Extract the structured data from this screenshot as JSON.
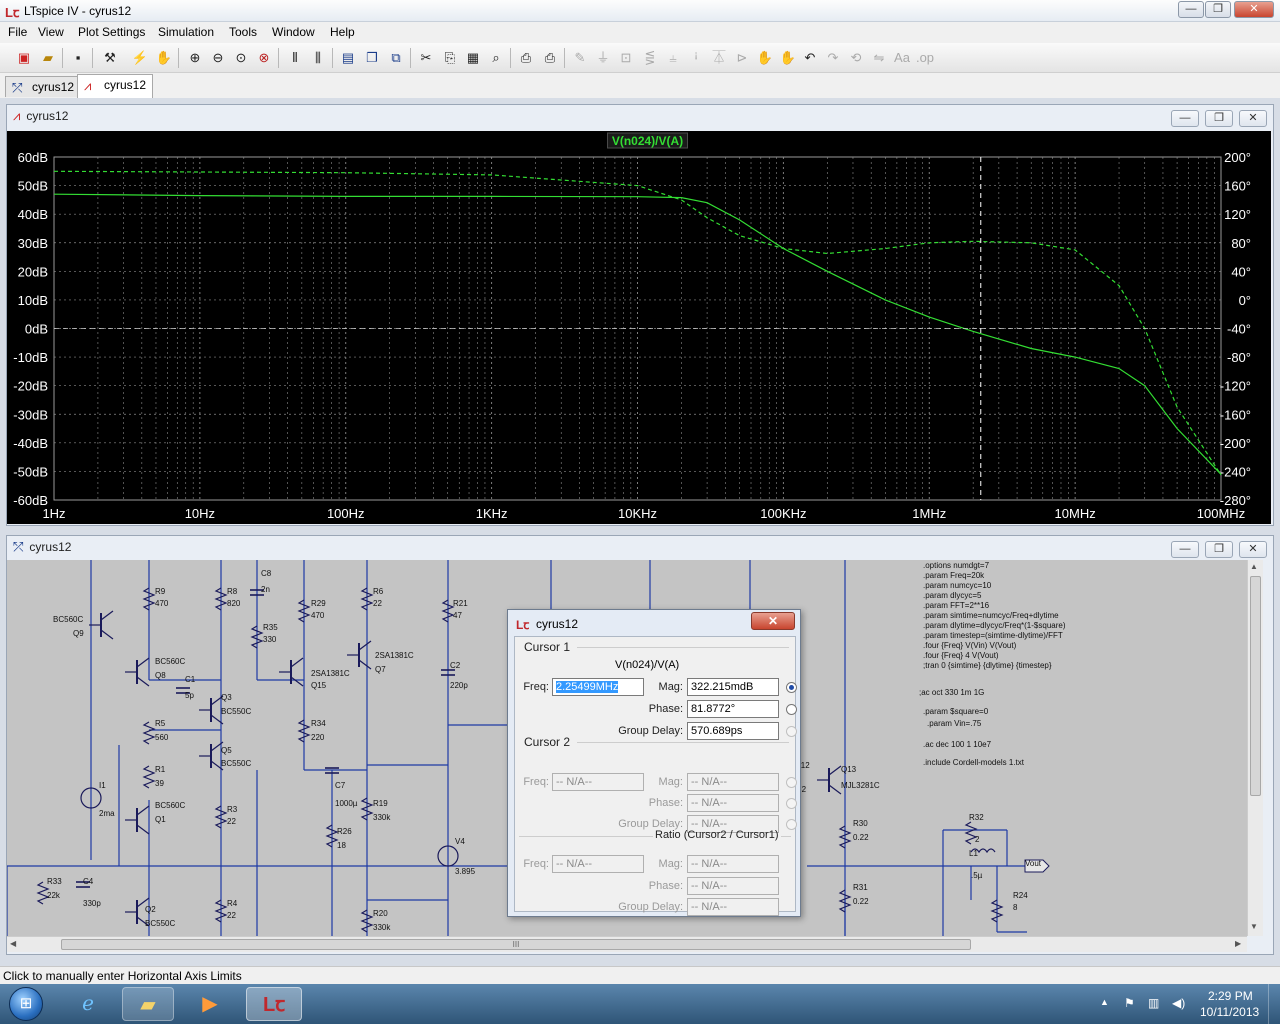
{
  "window": {
    "title": "LTspice IV - cyrus12"
  },
  "menu": [
    "File",
    "View",
    "Plot Settings",
    "Simulation",
    "Tools",
    "Window",
    "Help"
  ],
  "toolbar_icons": [
    "new-schematic-icon",
    "open-icon",
    "save-icon",
    "control-panel-icon",
    "run-icon",
    "halt-icon",
    "zoom-in-icon",
    "zoom-out-icon",
    "zoom-extents-icon",
    "zoom-cancel-icon",
    "autorange-icon",
    "mark-icon",
    "tile-horizontal-icon",
    "cascade-icon",
    "close-all-icon",
    "cut-icon",
    "copy-icon",
    "paste-icon",
    "find-icon",
    "print-setup-icon",
    "print-icon",
    "wire-icon",
    "ground-icon",
    "label-icon",
    "resistor-icon",
    "capacitor-icon",
    "inductor-icon",
    "diode-icon",
    "component-icon",
    "move-icon",
    "drag-icon",
    "undo-icon",
    "redo-icon",
    "rotate-icon",
    "mirror-icon",
    "text-icon",
    "spice-directive-icon"
  ],
  "tabs": [
    {
      "label": "cyrus12",
      "icon": "schematic-icon"
    },
    {
      "label": "cyrus12",
      "icon": "waveform-icon"
    }
  ],
  "plot_window": {
    "title": "cyrus12",
    "trace_label": "V(n024)/V(A)",
    "trace_color": "#33dd33"
  },
  "chart_data": {
    "type": "line",
    "title": "",
    "trace_label": "V(n024)/V(A)",
    "xscale": "log",
    "x_tick_labels": [
      "1Hz",
      "10Hz",
      "100Hz",
      "1KHz",
      "10KHz",
      "100KHz",
      "1MHz",
      "10MHz",
      "100MHz"
    ],
    "y_left_tick_labels": [
      "60dB",
      "50dB",
      "40dB",
      "30dB",
      "20dB",
      "10dB",
      "0dB",
      "-10dB",
      "-20dB",
      "-30dB",
      "-40dB",
      "-50dB",
      "-60dB"
    ],
    "y_right_tick_labels": [
      "200°",
      "160°",
      "120°",
      "80°",
      "40°",
      "0°",
      "-40°",
      "-80°",
      "-120°",
      "-160°",
      "-200°",
      "-240°",
      "-280°"
    ],
    "xlim": [
      1,
      100000000
    ],
    "ylim_left": [
      -60,
      60
    ],
    "ylim_right": [
      -280,
      200
    ],
    "cursor_x": 2254990,
    "series": [
      {
        "quantity": "magnitude",
        "style": "solid",
        "x": [
          1,
          10,
          100,
          1000,
          10000,
          20000,
          30000,
          50000,
          100000,
          200000,
          500000,
          1000000,
          2000000,
          5000000,
          10000000,
          20000000,
          30000000,
          50000000,
          100000000
        ],
        "y": [
          47,
          46.5,
          46.2,
          46.2,
          46.1,
          45.8,
          44,
          38,
          28,
          20,
          10,
          4,
          -1,
          -7,
          -10,
          -14,
          -20,
          -35,
          -51
        ]
      },
      {
        "quantity": "phase",
        "style": "dashed",
        "x": [
          1,
          10,
          100,
          1000,
          10000,
          20000,
          30000,
          50000,
          100000,
          200000,
          500000,
          1000000,
          2000000,
          5000000,
          10000000,
          20000000,
          30000000,
          50000000,
          100000000
        ],
        "y": [
          180,
          179,
          178,
          175,
          160,
          140,
          115,
          90,
          72,
          65,
          72,
          80,
          82,
          80,
          70,
          20,
          -40,
          -150,
          -245
        ]
      }
    ]
  },
  "schematic_window": {
    "title": "cyrus12",
    "hscroll_grip": "III",
    "labels": [
      "BC560C",
      "Q9",
      "R9",
      "470",
      "R8",
      "820",
      "C8",
      "2n",
      "R35",
      "330",
      "R29",
      "470",
      "R6",
      "22",
      "R21",
      "47",
      "BC560C",
      "Q8",
      "C1",
      "5p",
      "Q3",
      "BC550C",
      "2SA1381C",
      "Q15",
      "2SA1381C",
      "Q7",
      "C2",
      "220p",
      "R5",
      "560",
      "Q5",
      "BC550C",
      "R34",
      "220",
      "R1",
      "39",
      "I1",
      "2ma",
      "BC560C",
      "Q1",
      "R3",
      "22",
      "C7",
      "1000µ",
      "R19",
      "330k",
      "R26",
      "18",
      "V4",
      "3.895",
      "R33",
      "22k",
      "C4",
      "330p",
      "Q2",
      "BC550C",
      "R4",
      "22",
      "R20",
      "330k",
      "Q13",
      "MJL3281C",
      "R30",
      "0.22",
      "R31",
      "0.22",
      "R32",
      "2",
      "L1",
      ".5µ",
      "R24",
      "8",
      "Vout",
      "R12",
      "2.2"
    ],
    "directives": [
      ".options numdgt=7",
      ".param Freq=20k",
      ".param numcyc=10",
      ".param dlycyc=5",
      ".param FFT=2**16",
      ".param simtime=numcyc/Freq+dlytime",
      ".param dlytime=dlycyc/Freq*(1-$square)",
      ".param timestep=(simtime-dlytime)/FFT",
      ".four {Freq}  V(Vin) V(Vout)",
      ".four {Freq} 4 V(Vout)",
      ";tran 0 {simtime} {dlytime} {timestep}",
      ";ac oct 330 1m 1G",
      ".param $square=0",
      ".param Vin=.75",
      ".ac dec 100 1 10e7",
      ".include Cordell-models 1.txt"
    ]
  },
  "cursor_dialog": {
    "title": "cyrus12",
    "cursor1_label": "Cursor 1",
    "trace": "V(n024)/V(A)",
    "freq_label": "Freq:",
    "freq_value": "2.25499MHz",
    "mag_label": "Mag:",
    "mag_value": "322.215mdB",
    "phase_label": "Phase:",
    "phase_value": "81.8772°",
    "gd_label": "Group Delay:",
    "gd_value": "570.689ps",
    "cursor2_label": "Cursor 2",
    "na": "-- N/A--",
    "ratio_label": "Ratio (Cursor2 / Cursor1)"
  },
  "status": {
    "text": "Click to manually enter Horizontal Axis Limits"
  },
  "taskbar": {
    "time": "2:29 PM",
    "date": "10/11/2013",
    "apps": [
      "start-orb-icon",
      "internet-explorer-icon",
      "file-explorer-icon",
      "media-player-icon",
      "ltspice-icon"
    ]
  }
}
